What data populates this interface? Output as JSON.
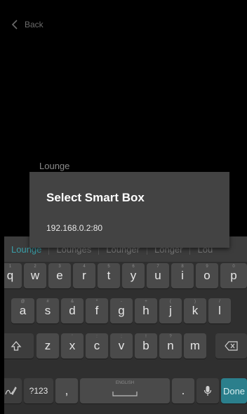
{
  "header": {
    "back_label": "Back"
  },
  "field": {
    "value": "Lounge"
  },
  "dialog": {
    "title": "Select Smart Box",
    "items": [
      "192.168.0.2:80"
    ]
  },
  "keyboard": {
    "suggestions": [
      "Lounge",
      "Lounges",
      "Lounger",
      "Longer",
      "Lou"
    ],
    "row1": [
      "q",
      "w",
      "e",
      "r",
      "t",
      "y",
      "u",
      "i",
      "o",
      "p"
    ],
    "row1_hints": [
      "1",
      "2",
      "3",
      "4",
      "5",
      "6",
      "7",
      "8",
      "9",
      "0"
    ],
    "row2": [
      "a",
      "s",
      "d",
      "f",
      "g",
      "h",
      "j",
      "k",
      "l"
    ],
    "row2_hints": [
      "@",
      "#",
      "&",
      "*",
      "-",
      "+",
      "(",
      ")",
      "/"
    ],
    "row3": [
      "z",
      "x",
      "c",
      "v",
      "b",
      "n",
      "m"
    ],
    "row3_hints": [
      "",
      "'",
      ":",
      ";",
      "!",
      "?",
      ""
    ],
    "symbols_label": "?123",
    "comma_label": ",",
    "period_label": ".",
    "space_hint": "ENGLISH",
    "done_label": "Done"
  },
  "colors": {
    "accent": "#2b7f8c",
    "dialog_bg": "#434343",
    "keyboard_bg": "#2f2f2f"
  },
  "icons": [
    "chevron-left-icon",
    "shift-icon",
    "backspace-icon",
    "handwriting-icon",
    "microphone-icon"
  ]
}
